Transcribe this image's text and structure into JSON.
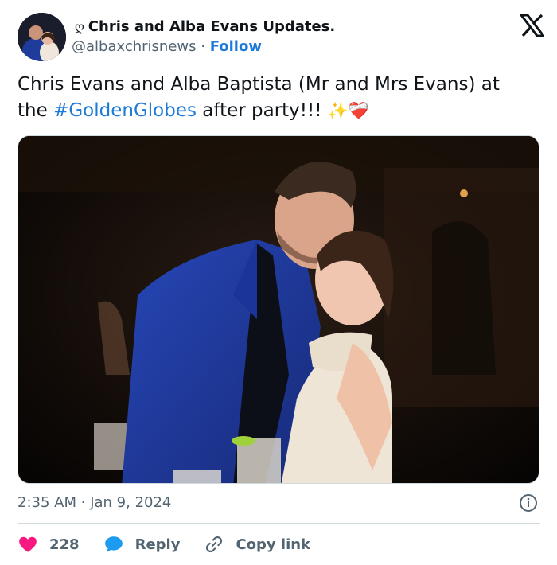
{
  "account": {
    "name_glyph": "ღ",
    "display_name": "Chris and Alba Evans Updates.",
    "handle": "@albaxchrisnews",
    "separator": "·",
    "follow_label": "Follow"
  },
  "tweet": {
    "text_part1": "Chris Evans and Alba Baptista (Mr and Mrs Evans) at the ",
    "hashtag": "#GoldenGlobes",
    "text_part2": " after party!!! ",
    "emoji": "✨❤️‍🩹"
  },
  "meta": {
    "time": "2:35 AM",
    "separator": "·",
    "date": "Jan 9, 2024"
  },
  "actions": {
    "like_count": "228",
    "reply_label": "Reply",
    "copy_link_label": "Copy link"
  },
  "colors": {
    "accent": "#1d7ad7",
    "like": "#f91880",
    "secondary_text": "#536471",
    "reply_icon": "#1d9bf0"
  },
  "icons": {
    "logo": "x-logo-icon",
    "info": "info-icon",
    "like": "heart-icon",
    "reply": "speech-bubble-icon",
    "copy_link": "link-icon"
  }
}
